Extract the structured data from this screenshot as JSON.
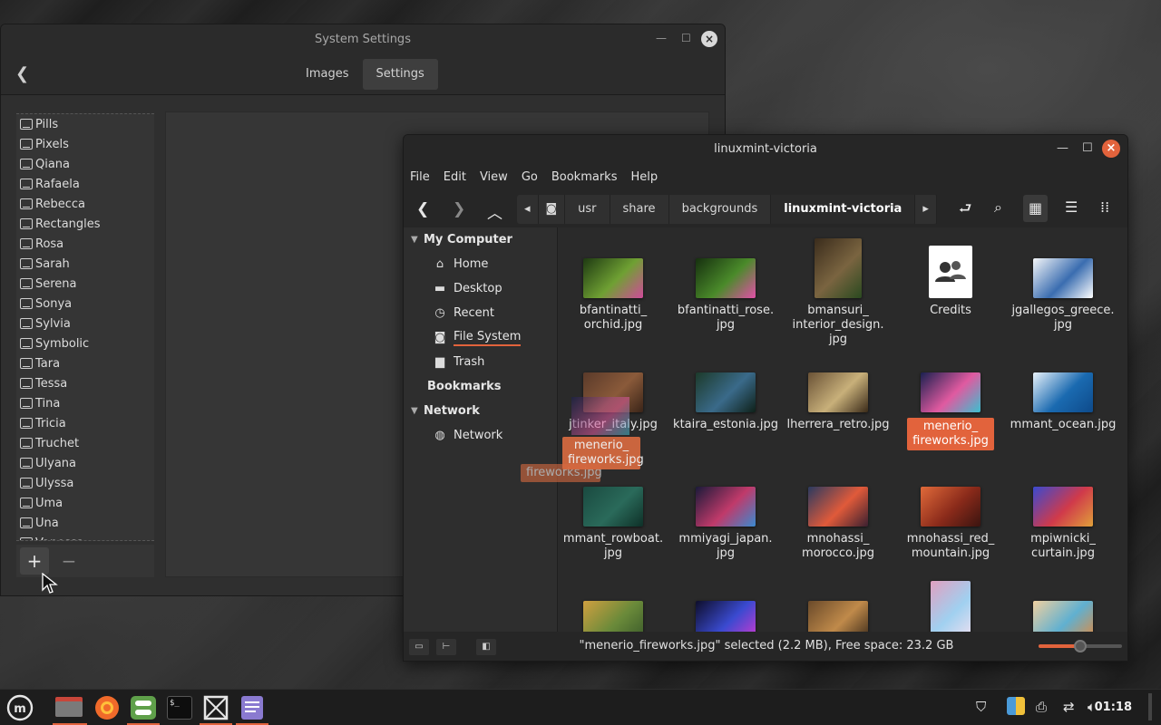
{
  "system_settings": {
    "title": "System Settings",
    "tabs": [
      {
        "label": "Images"
      },
      {
        "label": "Settings"
      }
    ],
    "themes": [
      "Pills",
      "Pixels",
      "Qiana",
      "Rafaela",
      "Rebecca",
      "Rectangles",
      "Rosa",
      "Sarah",
      "Serena",
      "Sonya",
      "Sylvia",
      "Symbolic",
      "Tara",
      "Tessa",
      "Tina",
      "Tricia",
      "Truchet",
      "Ulyana",
      "Ulyssa",
      "Uma",
      "Una",
      "Vanessa"
    ],
    "add_label": "+",
    "remove_label": "−"
  },
  "file_manager": {
    "title": "linuxmint-victoria",
    "menu": [
      "File",
      "Edit",
      "View",
      "Go",
      "Bookmarks",
      "Help"
    ],
    "path": [
      "usr",
      "share",
      "backgrounds",
      "linuxmint-victoria"
    ],
    "sidebar": {
      "my_computer": "My Computer",
      "items": [
        {
          "label": "Home",
          "icon": "home-icon"
        },
        {
          "label": "Desktop",
          "icon": "desktop-icon"
        },
        {
          "label": "Recent",
          "icon": "recent-icon"
        },
        {
          "label": "File System",
          "icon": "drive-icon"
        },
        {
          "label": "Trash",
          "icon": "trash-icon"
        }
      ],
      "bookmarks": "Bookmarks",
      "network": "Network",
      "network_items": [
        {
          "label": "Network",
          "icon": "network-icon"
        }
      ]
    },
    "files": [
      {
        "l1": "bfantinatti_",
        "l2": "orchid.jpg",
        "l3": "",
        "colors": [
          "#1e3a12",
          "#6fa033",
          "#d04a9a"
        ]
      },
      {
        "l1": "bfantinatti_rose.",
        "l2": "jpg",
        "l3": "",
        "colors": [
          "#16300f",
          "#4a8a2a",
          "#e24fa8"
        ]
      },
      {
        "l1": "bmansuri_",
        "l2": "interior_design.",
        "l3": "jpg",
        "colors": [
          "#3a2c1c",
          "#7a6440",
          "#2a4a20"
        ]
      },
      {
        "l1": "Credits",
        "l2": "",
        "l3": "",
        "colors": [
          "#ffffff",
          "#ffffff",
          "#333333"
        ]
      },
      {
        "l1": "jgallegos_greece.",
        "l2": "jpg",
        "l3": "",
        "colors": [
          "#f4f6f8",
          "#3a6db0",
          "#ffffff"
        ]
      },
      {
        "l1": "jtinker_italy.jpg",
        "l2": "",
        "l3": "",
        "colors": [
          "#5a3a2a",
          "#8a5a3a",
          "#3a2418"
        ]
      },
      {
        "l1": "ktaira_estonia.jpg",
        "l2": "",
        "l3": "",
        "colors": [
          "#1c3a2a",
          "#3a6a8a",
          "#0e2018"
        ]
      },
      {
        "l1": "lherrera_retro.jpg",
        "l2": "",
        "l3": "",
        "colors": [
          "#6a5236",
          "#c8b07a",
          "#3a2a18"
        ]
      },
      {
        "l1": "menerio_",
        "l2": "fireworks.jpg",
        "l3": "",
        "colors": [
          "#1a2050",
          "#e05aa0",
          "#3ac0d0"
        ],
        "selected": true
      },
      {
        "l1": "mmant_ocean.jpg",
        "l2": "",
        "l3": "",
        "colors": [
          "#e8f2fa",
          "#1a6ab0",
          "#0e4a8a"
        ]
      },
      {
        "l1": "mmant_rowboat.",
        "l2": "jpg",
        "l3": "",
        "colors": [
          "#1a4a40",
          "#2a6a5a",
          "#0e3028"
        ]
      },
      {
        "l1": "mmiyagi_japan.",
        "l2": "jpg",
        "l3": "",
        "colors": [
          "#1a1a3a",
          "#c03a6a",
          "#3a8ad0"
        ]
      },
      {
        "l1": "mnohassi_",
        "l2": "morocco.jpg",
        "l3": "",
        "colors": [
          "#2a3a60",
          "#e05a3a",
          "#3a2030"
        ]
      },
      {
        "l1": "mnohassi_red_",
        "l2": "mountain.jpg",
        "l3": "",
        "colors": [
          "#e06a3a",
          "#8a2a1a",
          "#3a1410"
        ]
      },
      {
        "l1": "mpiwnicki_",
        "l2": "curtain.jpg",
        "l3": "",
        "colors": [
          "#3a4ad0",
          "#d03a4a",
          "#e0a03a"
        ]
      },
      {
        "l1": "",
        "l2": "",
        "l3": "",
        "colors": [
          "#d0a040",
          "#6a8a3a",
          "#3a5a2a"
        ]
      },
      {
        "l1": "",
        "l2": "",
        "l3": "",
        "colors": [
          "#0e0e2a",
          "#3a4ad0",
          "#d03ad0"
        ]
      },
      {
        "l1": "",
        "l2": "",
        "l3": "",
        "colors": [
          "#6a4a2a",
          "#c08a4a",
          "#3a2a1a"
        ]
      },
      {
        "l1": "",
        "l2": "",
        "l3": "",
        "colors": [
          "#e0a0c0",
          "#a0d0f0",
          "#f0e0f0"
        ]
      },
      {
        "l1": "",
        "l2": "",
        "l3": "",
        "colors": [
          "#f0d0a0",
          "#60b0d0",
          "#e08a40"
        ]
      }
    ],
    "drag": {
      "l1": "menerio_",
      "l2": "fireworks.jpg",
      "ghost": "fireworks.jpg"
    },
    "status": "\"menerio_fireworks.jpg\" selected (2.2 MB), Free space: 23.2 GB",
    "zoom_fraction": 0.5
  },
  "taskbar": {
    "clock": "01:18",
    "apps": [
      "menu-icon",
      "files-icon",
      "firefox-icon",
      "settings-icon",
      "terminal-icon",
      "workspace-icon",
      "notes-icon"
    ]
  },
  "colors": {
    "accent": "#e2633c"
  }
}
